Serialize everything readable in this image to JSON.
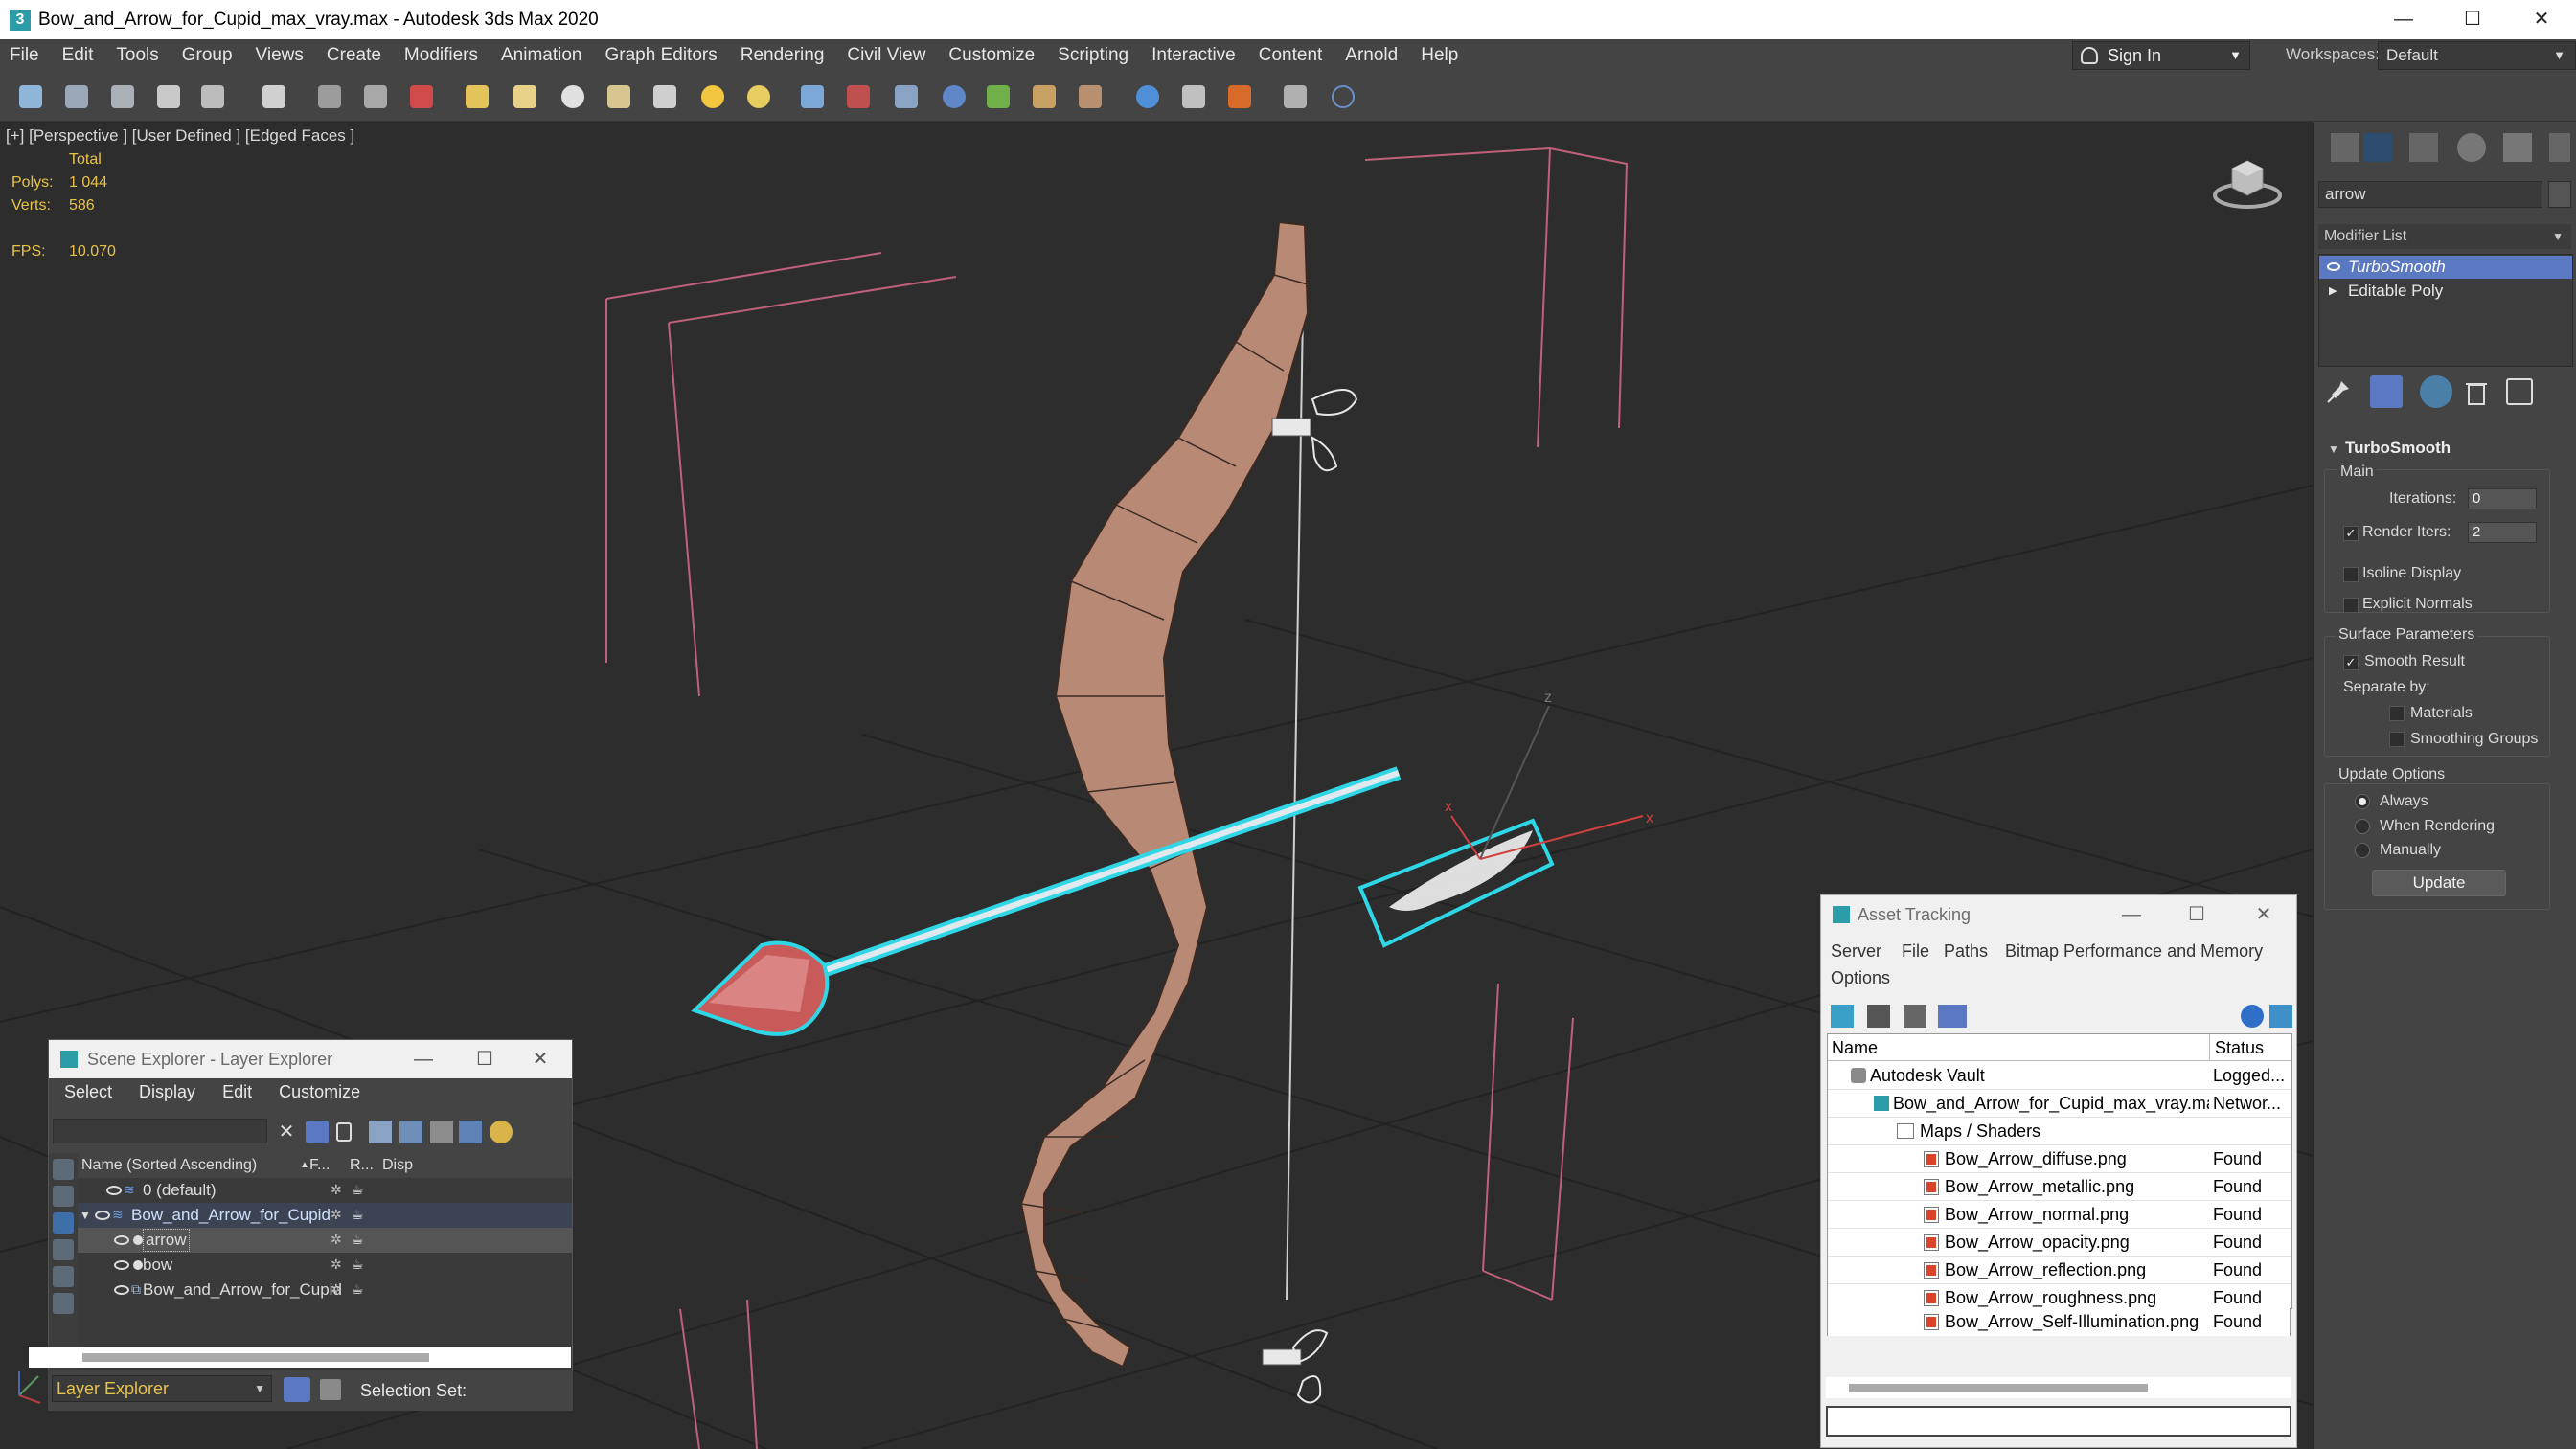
{
  "app": {
    "title": "Bow_and_Arrow_for_Cupid_max_vray.max - Autodesk 3ds Max 2020",
    "icon_text": "3"
  },
  "window_controls": {
    "minimize": "—",
    "maximize": "☐",
    "close": "✕"
  },
  "menu": [
    "File",
    "Edit",
    "Tools",
    "Group",
    "Views",
    "Create",
    "Modifiers",
    "Animation",
    "Graph Editors",
    "Rendering",
    "Civil View",
    "Customize",
    "Scripting",
    "Interactive",
    "Content",
    "Arnold",
    "Help"
  ],
  "signin": {
    "label": "Sign In",
    "arrow": "▼"
  },
  "workspaces": {
    "label": "Workspaces:",
    "value": "Default",
    "arrow": "▼"
  },
  "viewport": {
    "label": "[+] [Perspective ] [User Defined ] [Edged Faces ]",
    "stats": {
      "total_label": "Total",
      "polys_label": "Polys:",
      "polys_value": "1 044",
      "verts_label": "Verts:",
      "verts_value": "586",
      "fps_label": "FPS:",
      "fps_value": "10.070"
    }
  },
  "command_panel": {
    "object_name": "arrow",
    "modifier_list": "Modifier List",
    "modifier_list_arrow": "▼",
    "stack": [
      "TurboSmooth",
      "Editable Poly"
    ],
    "turbosmooth": {
      "title": "TurboSmooth",
      "main": "Main",
      "iterations_label": "Iterations:",
      "iterations_value": "0",
      "render_iters_label": "Render Iters:",
      "render_iters_value": "2",
      "render_iters_checked": "✓",
      "isoline": "Isoline Display",
      "explicit_normals": "Explicit Normals",
      "surface_params": "Surface Parameters",
      "smooth_result": "Smooth Result",
      "smooth_result_checked": "✓",
      "separate_by": "Separate by:",
      "materials": "Materials",
      "smoothing_groups": "Smoothing Groups",
      "update_options": "Update Options",
      "always": "Always",
      "when_rendering": "When Rendering",
      "manually": "Manually",
      "update": "Update"
    }
  },
  "scene_explorer": {
    "title": "Scene Explorer - Layer Explorer",
    "menu": [
      "Select",
      "Display",
      "Edit",
      "Customize"
    ],
    "columns": {
      "name": "Name (Sorted Ascending)",
      "frozen": "F...",
      "render": "R...",
      "display": "Disp"
    },
    "rows": [
      {
        "name": "0 (default)"
      },
      {
        "name": "Bow_and_Arrow_for_Cupid"
      },
      {
        "name": "arrow"
      },
      {
        "name": "bow"
      },
      {
        "name": "Bow_and_Arrow_for_Cupid"
      }
    ],
    "layer_explorer": "Layer Explorer",
    "selection_set": "Selection Set:"
  },
  "asset_tracking": {
    "title": "Asset Tracking",
    "menu": [
      "Server",
      "File",
      "Paths",
      "Bitmap Performance and Memory",
      "Options"
    ],
    "columns": {
      "name": "Name",
      "status": "Status"
    },
    "rows": [
      {
        "name": "Autodesk Vault",
        "status": "Logged..."
      },
      {
        "name": "Bow_and_Arrow_for_Cupid_max_vray.max",
        "status": "Networ..."
      },
      {
        "name": "Maps / Shaders",
        "status": ""
      },
      {
        "name": "Bow_Arrow_diffuse.png",
        "status": "Found"
      },
      {
        "name": "Bow_Arrow_metallic.png",
        "status": "Found"
      },
      {
        "name": "Bow_Arrow_normal.png",
        "status": "Found"
      },
      {
        "name": "Bow_Arrow_opacity.png",
        "status": "Found"
      },
      {
        "name": "Bow_Arrow_reflection.png",
        "status": "Found"
      },
      {
        "name": "Bow_Arrow_roughness.png",
        "status": "Found"
      },
      {
        "name": "Bow_Arrow_Self-Illumination.png",
        "status": "Found"
      }
    ]
  },
  "colors": {
    "accent": "#5b79c2",
    "stat_yellow": "#e8c34a",
    "selection_cyan": "#2fd6e6",
    "gizmo_pink": "#c0607a"
  }
}
